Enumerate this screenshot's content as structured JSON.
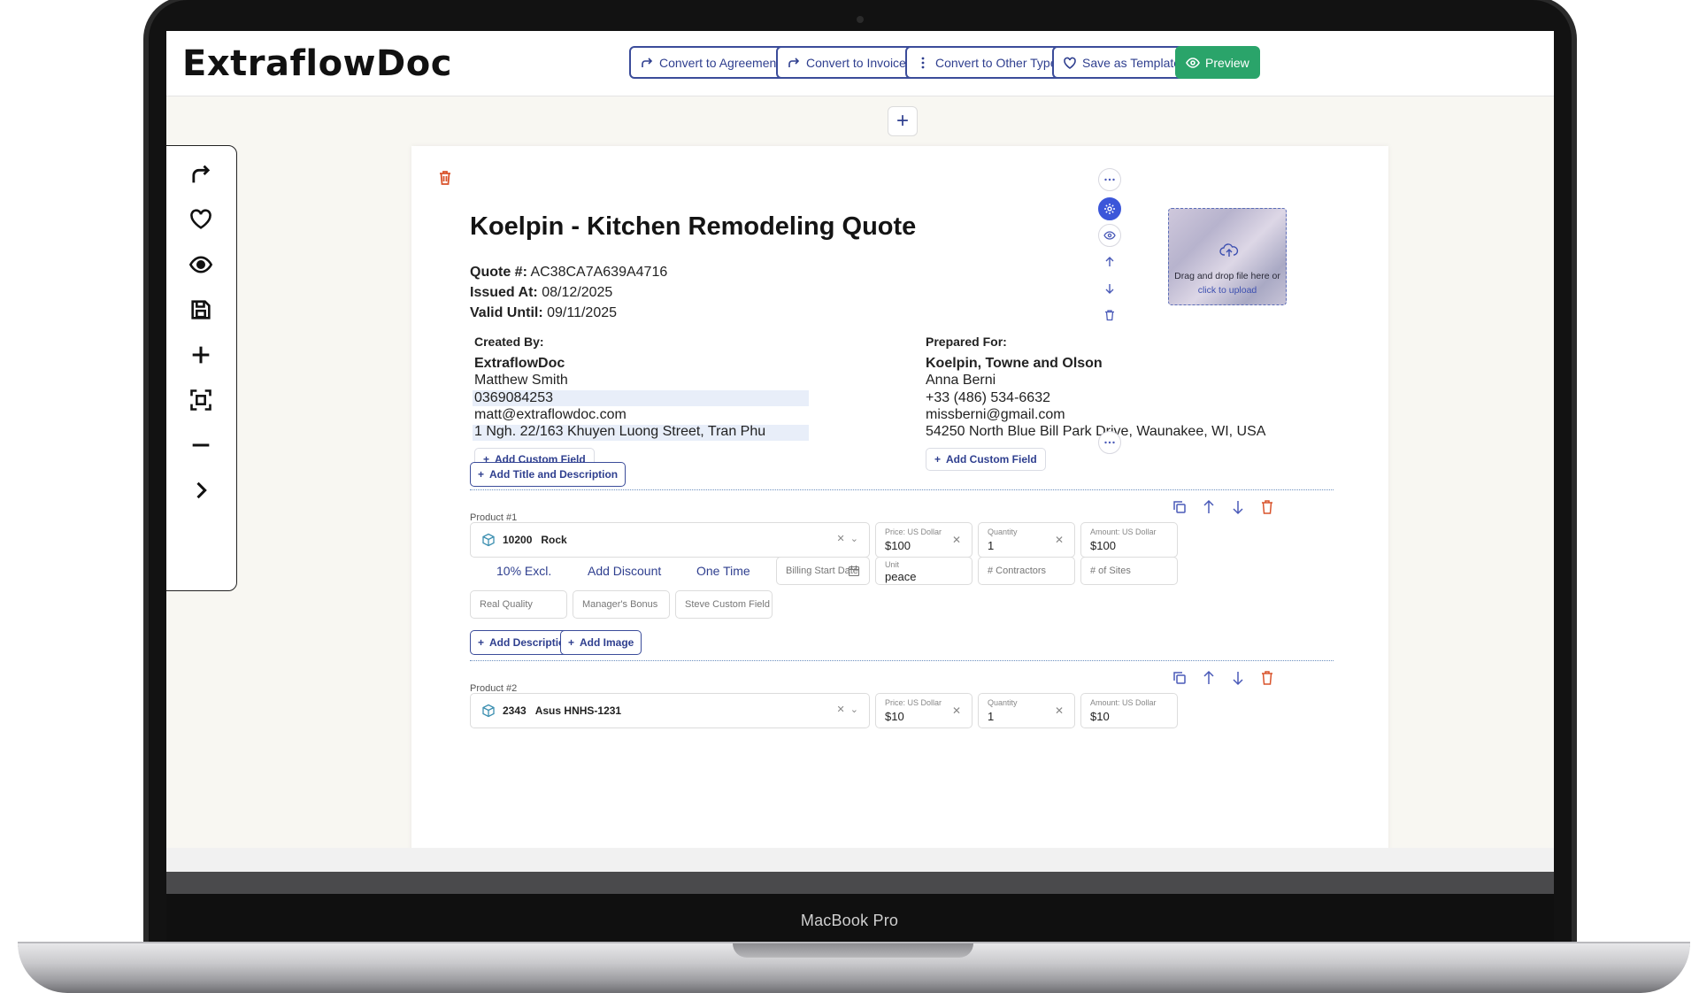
{
  "device": {
    "label": "MacBook Pro"
  },
  "header": {
    "logo": "ExtraflowDoc",
    "buttons": {
      "agreement": "Convert to Agreement",
      "invoice": "Convert to Invoice",
      "other": "Convert to Other Type",
      "template": "Save as Template",
      "preview": "Preview"
    }
  },
  "doc": {
    "title": "Koelpin - Kitchen Remodeling Quote",
    "meta": {
      "quote_label": "Quote #:",
      "quote_value": "AC38CA7A639A4716",
      "issued_label": "Issued At:",
      "issued_value": "08/12/2025",
      "valid_label": "Valid Until:",
      "valid_value": "09/11/2025"
    },
    "created_by": {
      "label": "Created By:",
      "company": "ExtraflowDoc",
      "name": "Matthew Smith",
      "phone": "0369084253",
      "email": "matt@extraflowdoc.com",
      "address": "1 Ngh. 22/163 Khuyen Luong Street, Tran Phu"
    },
    "prepared_for": {
      "label": "Prepared For:",
      "company": "Koelpin, Towne and Olson",
      "name": "Anna Berni",
      "phone": "+33 (486) 534-6632",
      "email": "missberni@gmail.com",
      "address": "54250 North Blue Bill Park Drive, Waunakee, WI, USA"
    },
    "add_custom_field": "Add Custom Field",
    "add_title_desc": "Add Title and Description",
    "image_drop": {
      "line1": "Drag and drop file here or",
      "line2": "click to upload"
    }
  },
  "products": [
    {
      "label": "Product #1",
      "code": "10200",
      "name": "Rock",
      "price_label": "Price: US Dollar",
      "price": "$100",
      "qty_label": "Quantity",
      "qty": "1",
      "amount_label": "Amount: US Dollar",
      "amount": "$100",
      "tax": "10% Excl.",
      "discount": "Add Discount",
      "frequency": "One Time",
      "billing_start": "Billing Start Date",
      "unit_label": "Unit",
      "unit": "peace",
      "contractors": "# Contractors",
      "sites": "# of Sites",
      "custom1": "Real Quality",
      "custom2": "Manager's Bonus",
      "custom3": "Steve Custom Field",
      "add_description": "Add Description",
      "add_image": "Add Image"
    },
    {
      "label": "Product #2",
      "code": "2343",
      "name": "Asus HNHS-1231",
      "price_label": "Price: US Dollar",
      "price": "$10",
      "qty_label": "Quantity",
      "qty": "1",
      "amount_label": "Amount: US Dollar",
      "amount": "$10"
    }
  ],
  "colors": {
    "accent": "#2f3f8f",
    "success": "#2aa46a",
    "danger": "#d9532b"
  }
}
